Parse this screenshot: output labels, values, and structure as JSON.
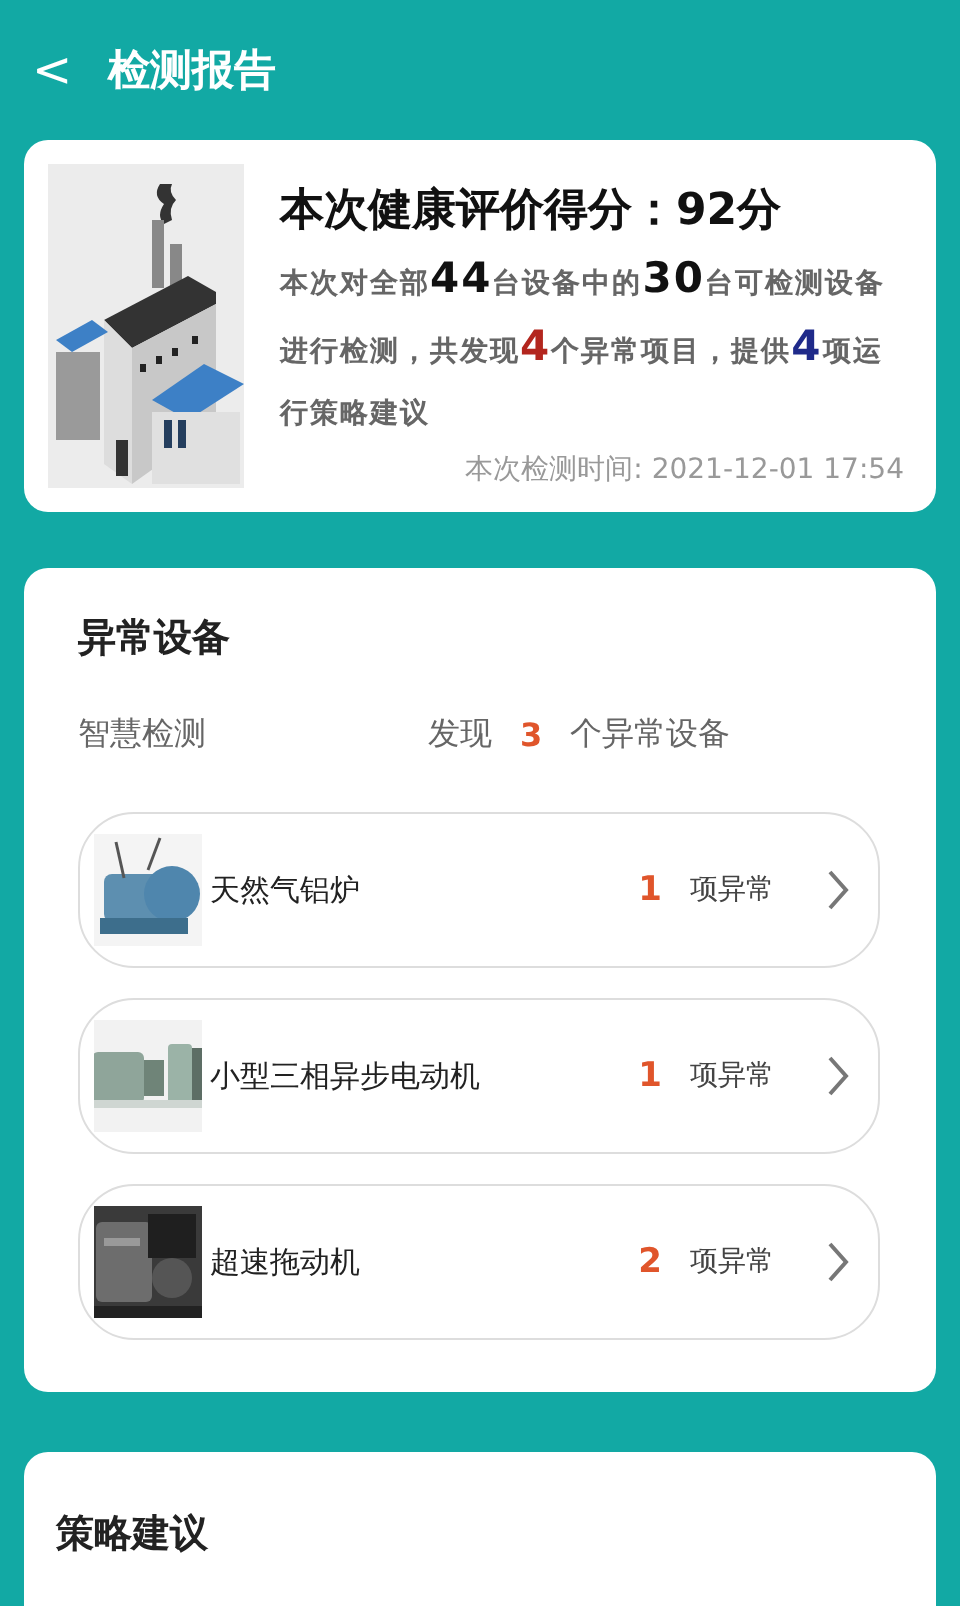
{
  "header": {
    "back_icon": "<",
    "title": "检测报告"
  },
  "summary": {
    "score_title": "本次健康评价得分：92分",
    "description": [
      {
        "kind": "text",
        "text": "本次对全部"
      },
      {
        "kind": "number",
        "text": "44"
      },
      {
        "kind": "text",
        "text": "台设备中的"
      },
      {
        "kind": "number",
        "text": "30"
      },
      {
        "kind": "text",
        "text": "台可检测设备进行检测，共发现"
      },
      {
        "kind": "alert",
        "text": "4"
      },
      {
        "kind": "text",
        "text": "个异常项目，提供"
      },
      {
        "kind": "advice",
        "text": "4"
      },
      {
        "kind": "text",
        "text": "项运行策略建议"
      }
    ],
    "time": "本次检测时间: 2021-12-01 17:54"
  },
  "abnormal": {
    "title": "异常设备",
    "source": "智慧检测",
    "found_prefix": "发现",
    "found_count": "3",
    "found_suffix": "个异常设备",
    "devices": [
      {
        "name": "天然气铝炉",
        "count": "1",
        "unit": "项异常",
        "kind": "picture"
      },
      {
        "name": "小型三相异步电动机",
        "count": "1",
        "unit": "项异常",
        "kind": "picture"
      },
      {
        "name": "超速拖动机",
        "count": "2",
        "unit": "项异常",
        "kind": "picture"
      }
    ]
  },
  "strategy": {
    "title": "策略建议"
  }
}
